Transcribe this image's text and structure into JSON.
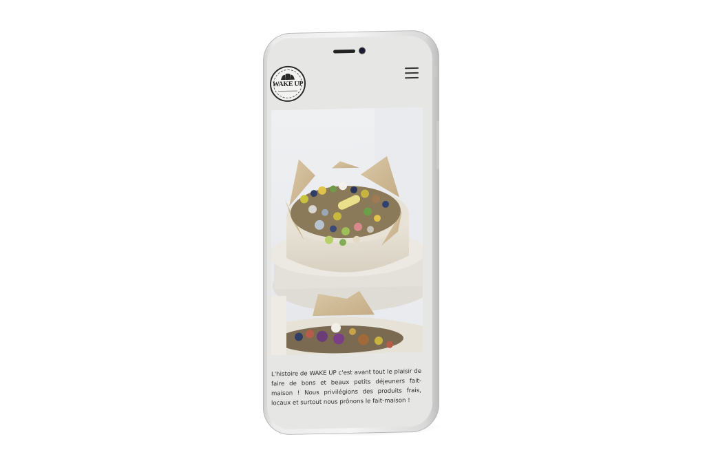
{
  "brand": {
    "logo_text": "WAKE UP",
    "logo_icon": "croissant-icon"
  },
  "header": {
    "menu_icon": "hamburger-menu-icon"
  },
  "hero": {
    "image_subject": "food-box-photo"
  },
  "intro": {
    "paragraph": "L'histoire de WAKE UP c'est avant tout le plaisir de faire de bons et beaux petits déjeuners fait-maison ! Nous privilégions des produits frais, locaux et surtout nous prônons le fait-maison !"
  },
  "colors": {
    "screen_bg": "#e6e6e5",
    "text": "#2f2f2f",
    "logo_ink": "#2a2a2a"
  }
}
